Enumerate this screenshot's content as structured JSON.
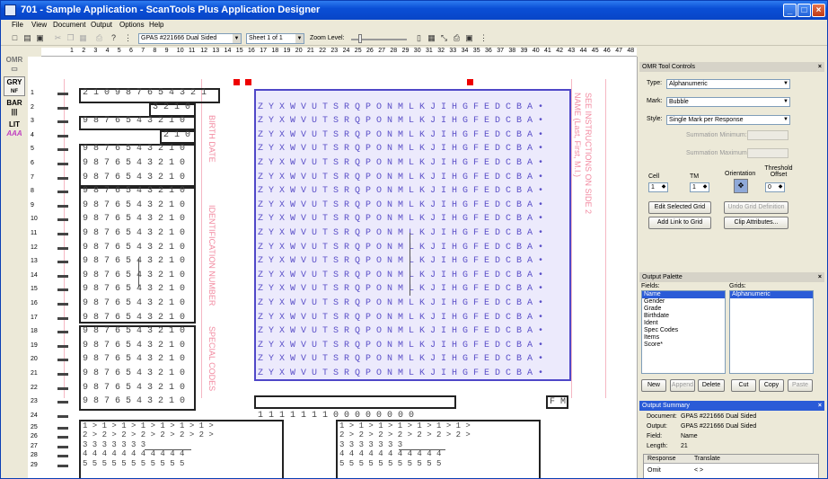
{
  "window": {
    "title": "701 - Sample Application - ScanTools Plus Application Designer",
    "min": "_",
    "max": "□",
    "close": "×"
  },
  "menu": [
    "File",
    "View",
    "Document",
    "Output",
    "Options",
    "Help"
  ],
  "toolbar": {
    "form_combo": "GPAS #221666 Dual Sided",
    "sheet_combo": "Sheet 1 of 1",
    "zoom_label": "Zoom Level:"
  },
  "left_tools": [
    {
      "l1": "OMR",
      "l2": "▭"
    },
    {
      "l1": "GRY",
      "l2": "NF"
    },
    {
      "l1": "BAR",
      "l2": "|||"
    },
    {
      "l1": "LIT",
      "l2": "AAA"
    }
  ],
  "ruler_cols": [
    "1",
    "2",
    "3",
    "4",
    "5",
    "6",
    "7",
    "8",
    "9",
    "10",
    "11",
    "12",
    "13",
    "14",
    "15",
    "16",
    "17",
    "18",
    "19",
    "20",
    "21",
    "22",
    "23",
    "24",
    "25",
    "26",
    "27",
    "28",
    "29",
    "30",
    "31",
    "32",
    "33",
    "34",
    "35",
    "36",
    "37",
    "38",
    "39",
    "40",
    "41",
    "42",
    "43",
    "44",
    "45",
    "46",
    "47",
    "48"
  ],
  "rows_top": [
    "1",
    "2",
    "3",
    "4",
    "5",
    "6",
    "7",
    "8",
    "9",
    "10",
    "11",
    "12",
    "13",
    "14",
    "15",
    "16",
    "17",
    "18",
    "19",
    "20",
    "21",
    "22",
    "23",
    "24"
  ],
  "rows_bottom": [
    "25",
    "26",
    "27",
    "28",
    "29"
  ],
  "sheet": {
    "digit_rows": [
      "2 1 0 9 8 7 6 5 4 3 2 1",
      "3 2 1 0",
      "9 8 7 6 5 4 3 2 1 0",
      "2 1 0",
      "9 8 7 6 5 4 3 2 1 0",
      "9 8 7 6 5 4 3 2 1 0",
      "9 8 7 6 5 4 3 2 1 0",
      "9 8 7 6 5 4 3 2 1 0",
      "9 8 7 6 5 4 3 2 1 0",
      "9 8 7 6 5 4 3 2 1 0",
      "9 8 7 6 5 4 3 2 1 0",
      "9 8 7 6 5 4 3 2 1 0",
      "9 8 7 6 5 4 3 2 1 0",
      "9 8 7 6 5 4 3 2 1 0",
      "9 8 7 6 5 4 3 2 1 0",
      "9 8 7 6 5 4 3 2 1 0",
      "9 8 7 6 5 4 3 2 1 0",
      "9 8 7 6 5 4 3 2 1 0",
      "9 8 7 6 5 4 3 2 1 0",
      "9 8 7 6 5 4 3 2 1 0",
      "9 8 7 6 5 4 3 2 1 0",
      "9 8 7 6 5 4 3 2 1 0",
      "9 8 7 6 5 4 3 2 1 0"
    ],
    "alpha_row": "Z Y X W V U T S R Q P O N M L K J I H G F E D C B A •",
    "ones_row": "1 1 1 1 1 1 1 0 0 0 0 0 0 0 0",
    "side_box": "F M",
    "bottom_left_rows": [
      "1 > 1 > 1 > 1 > 1 > 1 > 1 >",
      "2 > 2 > 2 > 2 > 2 > 2 > 2 >",
      "3 3 3          3 3 3 3",
      "4 4 4 4 4 4 4 4 4 4 4",
      "5 5 5 5 5 5 5 5 5 5 5"
    ],
    "bottom_right_rows": [
      "1 > 1 > 1 > 1 > 1 > 1 > 1 >",
      "2 > 2 > 2 > 2 > 2 > 2 > 2 >",
      "3 3 3          3 3 3 3",
      "4 4 4 4 4 4 4 4 4 4 4",
      "5 5 5 5 5 5 5 5 5 5 5"
    ],
    "pink_text": [
      "BIRTH DATE",
      "IDENTIFICATION NUMBER",
      "SPECIAL CODES",
      "SEE INSTRUCTIONS ON SIDE 2",
      "NAME (Last, First, M.I.)"
    ]
  },
  "omr_panel": {
    "title": "OMR Tool Controls",
    "type_label": "Type:",
    "type_value": "Alphanumeric",
    "mark_label": "Mark:",
    "mark_value": "Bubble",
    "style_label": "Style:",
    "style_value": "Single Mark per Response",
    "sum_min": "Summation Minimum:",
    "sum_max": "Summation Maximum:",
    "cell_label": "Cell",
    "cell_value": "1",
    "tm_label": "TM",
    "tm_value": "1",
    "orient_label": "Orientation",
    "thresh_label": "Threshold Offset",
    "thresh_value": "0",
    "btn_edit": "Edit Selected Grid",
    "btn_undo": "Undo Grid Definition",
    "btn_link": "Add Link to Grid",
    "btn_clip": "Clip Attributes..."
  },
  "palette": {
    "title": "Output Palette",
    "fields_label": "Fields:",
    "grids_label": "Grids:",
    "fields": [
      "Name",
      "Gender",
      "Grade",
      "Birthdate",
      "Ident",
      "Spec Codes",
      "Items",
      "Score*"
    ],
    "grids": [
      "Alphanumeric"
    ],
    "btns": [
      "New",
      "Append",
      "Delete",
      "Cut",
      "Copy",
      "Paste"
    ]
  },
  "summary": {
    "title": "Output Summary",
    "document_label": "Document:",
    "document_value": "GPAS #221666 Dual Sided",
    "output_label": "Output:",
    "output_value": "GPAS #221666 Dual Sided",
    "field_label": "Field:",
    "field_value": "Name",
    "length_label": "Length:",
    "length_value": "21",
    "col1": "Response",
    "col2": "Translate",
    "row1_resp": "Omit",
    "row1_trans": "< >"
  }
}
